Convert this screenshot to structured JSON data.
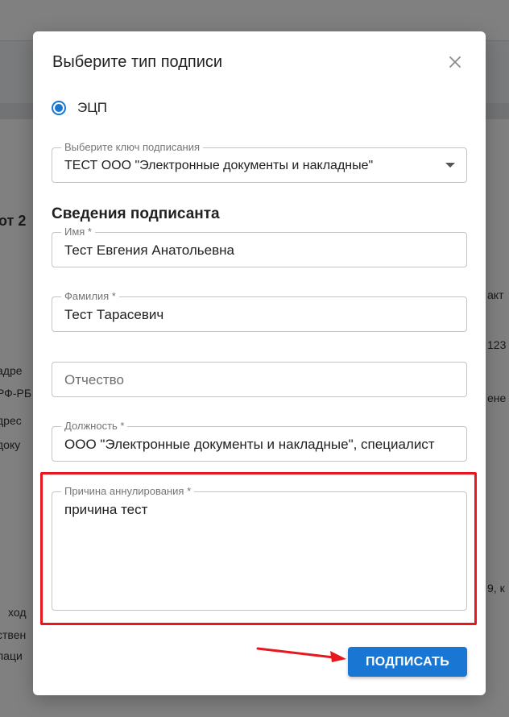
{
  "background_page": {
    "fragments": [
      "от 2",
      "адре",
      "РФ-РБ",
      "дрес",
      "доку",
      "ход",
      "ствен",
      "лаци",
      "акт",
      "123",
      "ене",
      "9, к"
    ]
  },
  "modal": {
    "title": "Выберите тип подписи",
    "close_icon": "close-icon",
    "radio_label": "ЭЦП",
    "key_select": {
      "legend": "Выберите ключ подписания",
      "value": "ТЕСТ ООО \"Электронные документы и накладные\""
    },
    "section_title": "Сведения подписанта",
    "first_name": {
      "legend": "Имя *",
      "value": "Тест Евгения Анатольевна"
    },
    "last_name": {
      "legend": "Фамилия *",
      "value": "Тест Тарасевич"
    },
    "patronymic": {
      "placeholder": "Отчество"
    },
    "position": {
      "legend": "Должность *",
      "value": "ООО \"Электронные документы и накладные\", специалист"
    },
    "reason": {
      "legend": "Причина аннулирования *",
      "value": "причина тест"
    },
    "sign_button": "ПОДПИСАТЬ"
  },
  "colors": {
    "accent": "#1976d2",
    "highlight": "#e8171e"
  }
}
